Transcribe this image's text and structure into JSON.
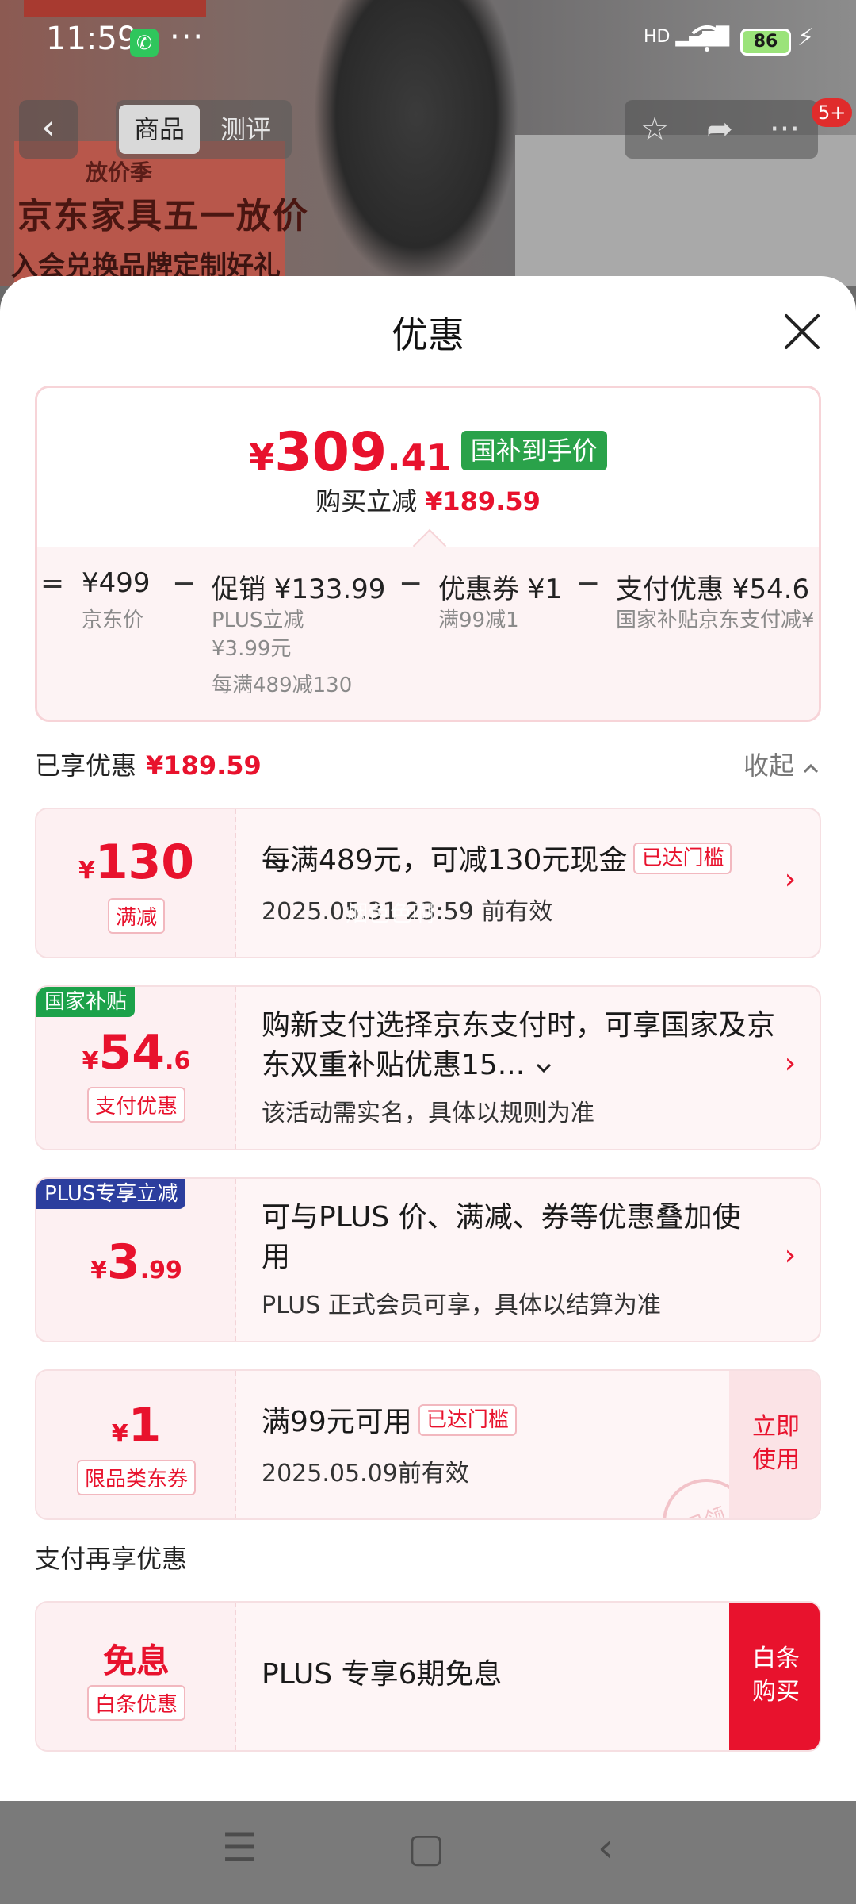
{
  "status_bar": {
    "time": "11:59",
    "dots": "···",
    "battery": "86",
    "signal_label": "HD"
  },
  "background_page": {
    "banner_line1": "放价季",
    "banner_line2": "京东家具五一放价",
    "banner_line3": "入会兑换品牌定制好礼",
    "tabs": [
      "商品",
      "测评"
    ],
    "badge": "5+"
  },
  "sheet": {
    "title": "优惠",
    "summary": {
      "price_symbol": "¥",
      "price_int": "309",
      "price_dec": ".41",
      "price_tag": "国补到手价",
      "reduce_label": "购买立减",
      "reduce_value": "¥189.59",
      "breakdown": [
        {
          "op": "=",
          "main": "¥499",
          "sub1": "京东价"
        },
        {
          "op": "−",
          "main": "促销 ¥133.99",
          "sub1": "PLUS立减",
          "sub2": "¥3.99元",
          "sub3": "每满489减130"
        },
        {
          "op": "−",
          "main": "优惠券 ¥1",
          "sub1": "满99减1"
        },
        {
          "op": "−",
          "main": "支付优惠 ¥54.6",
          "sub1": "国家补贴京东支付减¥"
        }
      ]
    },
    "enjoyed": {
      "label": "已享优惠",
      "value": "¥189.59",
      "collapse": "收起"
    },
    "offers": [
      {
        "symbol": "¥",
        "amount": "130",
        "decimal": "",
        "type": "满减",
        "title": "每满489元，可减130元现金",
        "threshold": "已达门槛",
        "sub": "2025.05.31 23:59 前有效"
      },
      {
        "corner": "国家补贴",
        "symbol": "¥",
        "amount": "54",
        "decimal": ".6",
        "type": "支付优惠",
        "title": "购新支付选择京东支付时，可享国家及京东双重补贴优惠15...",
        "sub": "该活动需实名，具体以规则为准"
      },
      {
        "corner": "PLUS专享立减",
        "symbol": "¥",
        "amount": "3",
        "decimal": ".99",
        "title": "可与PLUS 价、满减、券等优惠叠加使用",
        "sub": "PLUS 正式会员可享，具体以结算为准"
      },
      {
        "symbol": "¥",
        "amount": "1",
        "decimal": "",
        "type": "限品类东券",
        "title": "满99元可用",
        "threshold": "已达门槛",
        "sub": "2025.05.09前有效",
        "action": "立即使用",
        "stamp": "已领"
      }
    ],
    "watermark": "烟色色啊",
    "pay_section": {
      "label": "支付再享优惠"
    },
    "pay_offer": {
      "big": "免息",
      "type": "白条优惠",
      "title": "PLUS 专享6期免息",
      "action": "白条购买"
    }
  },
  "colors": {
    "accent": "#e8122d",
    "gov_green": "#2aa24a",
    "plus_blue": "#2c3e9e"
  }
}
